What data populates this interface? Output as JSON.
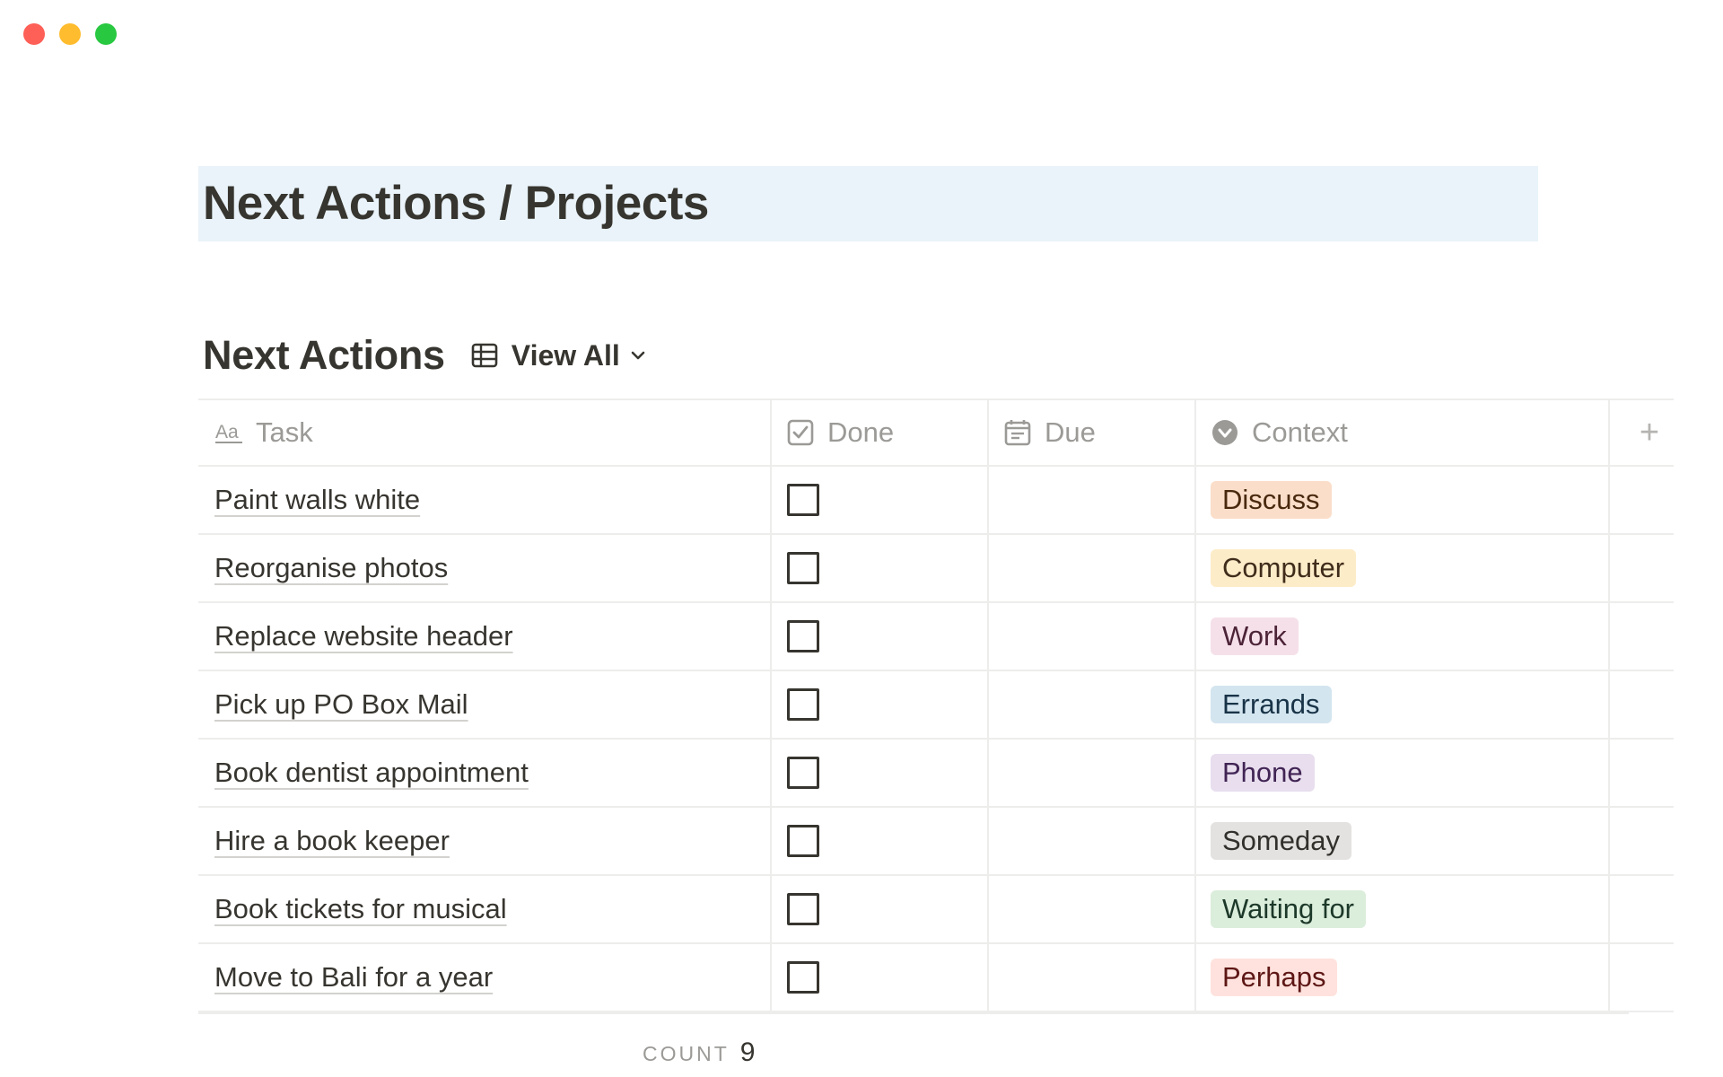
{
  "page": {
    "title": "Next Actions / Projects"
  },
  "database": {
    "title": "Next Actions",
    "view": {
      "label": "View All",
      "icon": "table-icon"
    },
    "columns": [
      {
        "label": "Task",
        "icon": "text-property-icon"
      },
      {
        "label": "Done",
        "icon": "checkbox-property-icon"
      },
      {
        "label": "Due",
        "icon": "calendar-icon"
      },
      {
        "label": "Context",
        "icon": "select-property-icon"
      }
    ],
    "add_column": "+",
    "rows": [
      {
        "task": "Paint walls white",
        "done": false,
        "due": "",
        "context": "Discuss",
        "tag_bg": "#fadec9",
        "tag_fg": "#49290e"
      },
      {
        "task": "Reorganise photos",
        "done": false,
        "due": "",
        "context": "Computer",
        "tag_bg": "#fdecc8",
        "tag_fg": "#402c1b"
      },
      {
        "task": "Replace website header",
        "done": false,
        "due": "",
        "context": "Work",
        "tag_bg": "#f5e0e9",
        "tag_fg": "#4c2337"
      },
      {
        "task": "Pick up PO Box Mail",
        "done": false,
        "due": "",
        "context": "Errands",
        "tag_bg": "#d3e5ef",
        "tag_fg": "#183347"
      },
      {
        "task": "Book dentist appointment",
        "done": false,
        "due": "",
        "context": "Phone",
        "tag_bg": "#e8deee",
        "tag_fg": "#412454"
      },
      {
        "task": "Hire a book keeper",
        "done": false,
        "due": "",
        "context": "Someday",
        "tag_bg": "#e3e2e0",
        "tag_fg": "#32302c"
      },
      {
        "task": "Book tickets for musical",
        "done": false,
        "due": "",
        "context": "Waiting for",
        "tag_bg": "#dbeddb",
        "tag_fg": "#1c3829"
      },
      {
        "task": "Move to Bali for a year",
        "done": false,
        "due": "",
        "context": "Perhaps",
        "tag_bg": "#ffe2dd",
        "tag_fg": "#5d1715"
      }
    ],
    "footer": {
      "count_label": "COUNT",
      "count_value": "9"
    }
  }
}
